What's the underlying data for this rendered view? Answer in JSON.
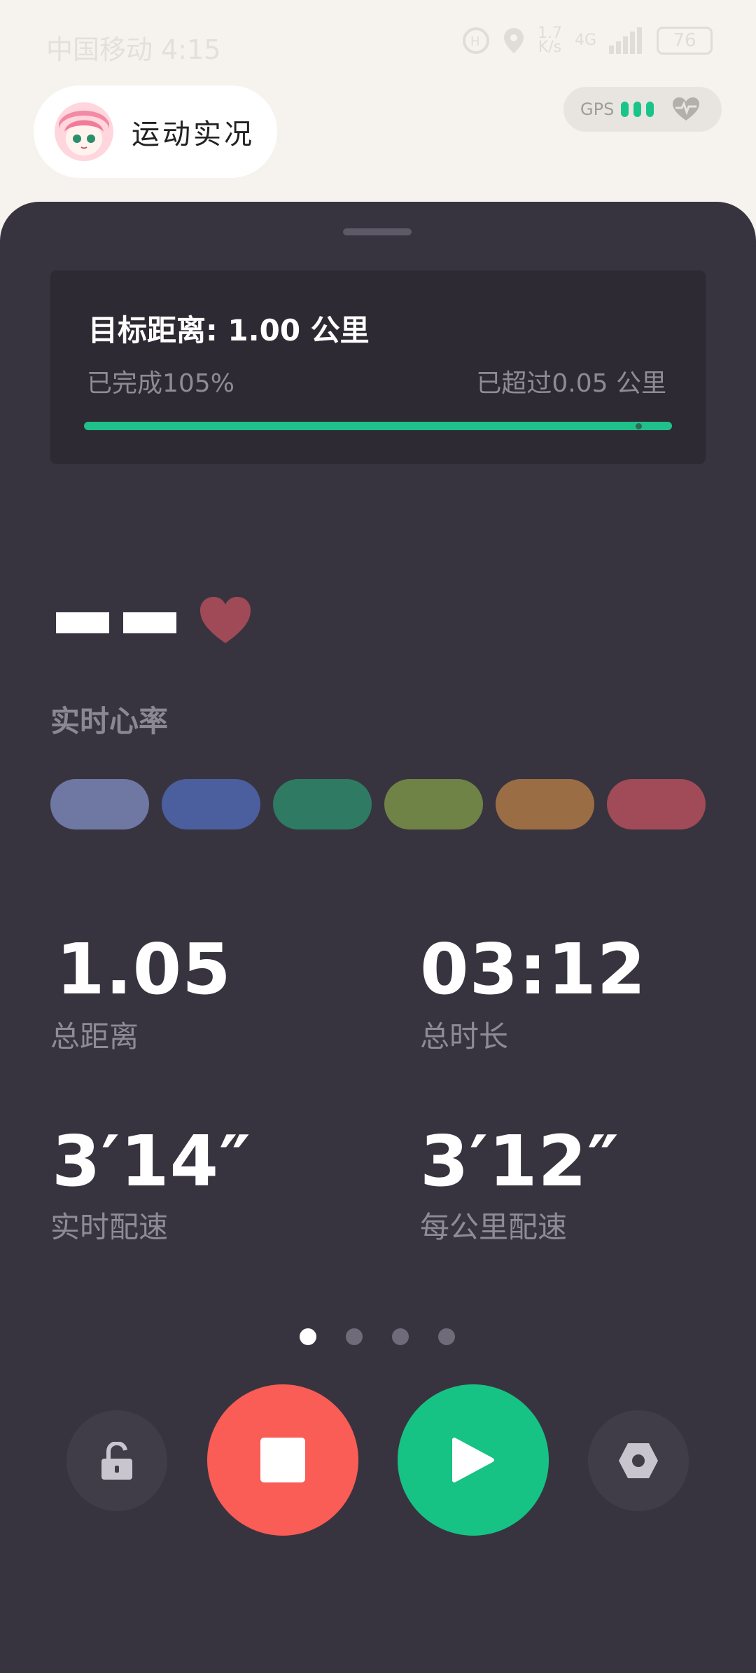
{
  "status_bar": {
    "carrier_time": "中国移动 4:15",
    "net_speed_value": "1.7",
    "net_speed_unit": "K/s",
    "network_type": "4G",
    "battery": "76"
  },
  "header": {
    "title": "运动实况",
    "gps_label": "GPS"
  },
  "target": {
    "title": "目标距离: 1.00 公里",
    "completed": "已完成105%",
    "exceeded": "已超过0.05 公里",
    "progress_fraction": 1.0
  },
  "heart_rate": {
    "value": "--",
    "label": "实时心率",
    "zone_colors": [
      "#6f77a3",
      "#4b5e9d",
      "#2f7a62",
      "#6f8347",
      "#9b6d45",
      "#a04b57"
    ]
  },
  "stats": [
    {
      "value": "1.05",
      "label": "总距离"
    },
    {
      "value": "03:12",
      "label": "总时长"
    },
    {
      "value": "3′14″",
      "label": "实时配速"
    },
    {
      "value": "3′12″",
      "label": "每公里配速"
    }
  ],
  "pager": {
    "count": 4,
    "active": 0
  },
  "controls": {
    "lock_icon": "unlock-icon",
    "stop_icon": "stop-icon",
    "play_icon": "play-icon",
    "settings_icon": "hexagon-settings-icon"
  },
  "colors": {
    "accent_green": "#17c285",
    "stop_red": "#fa5c56",
    "card_bg": "#38343f"
  }
}
